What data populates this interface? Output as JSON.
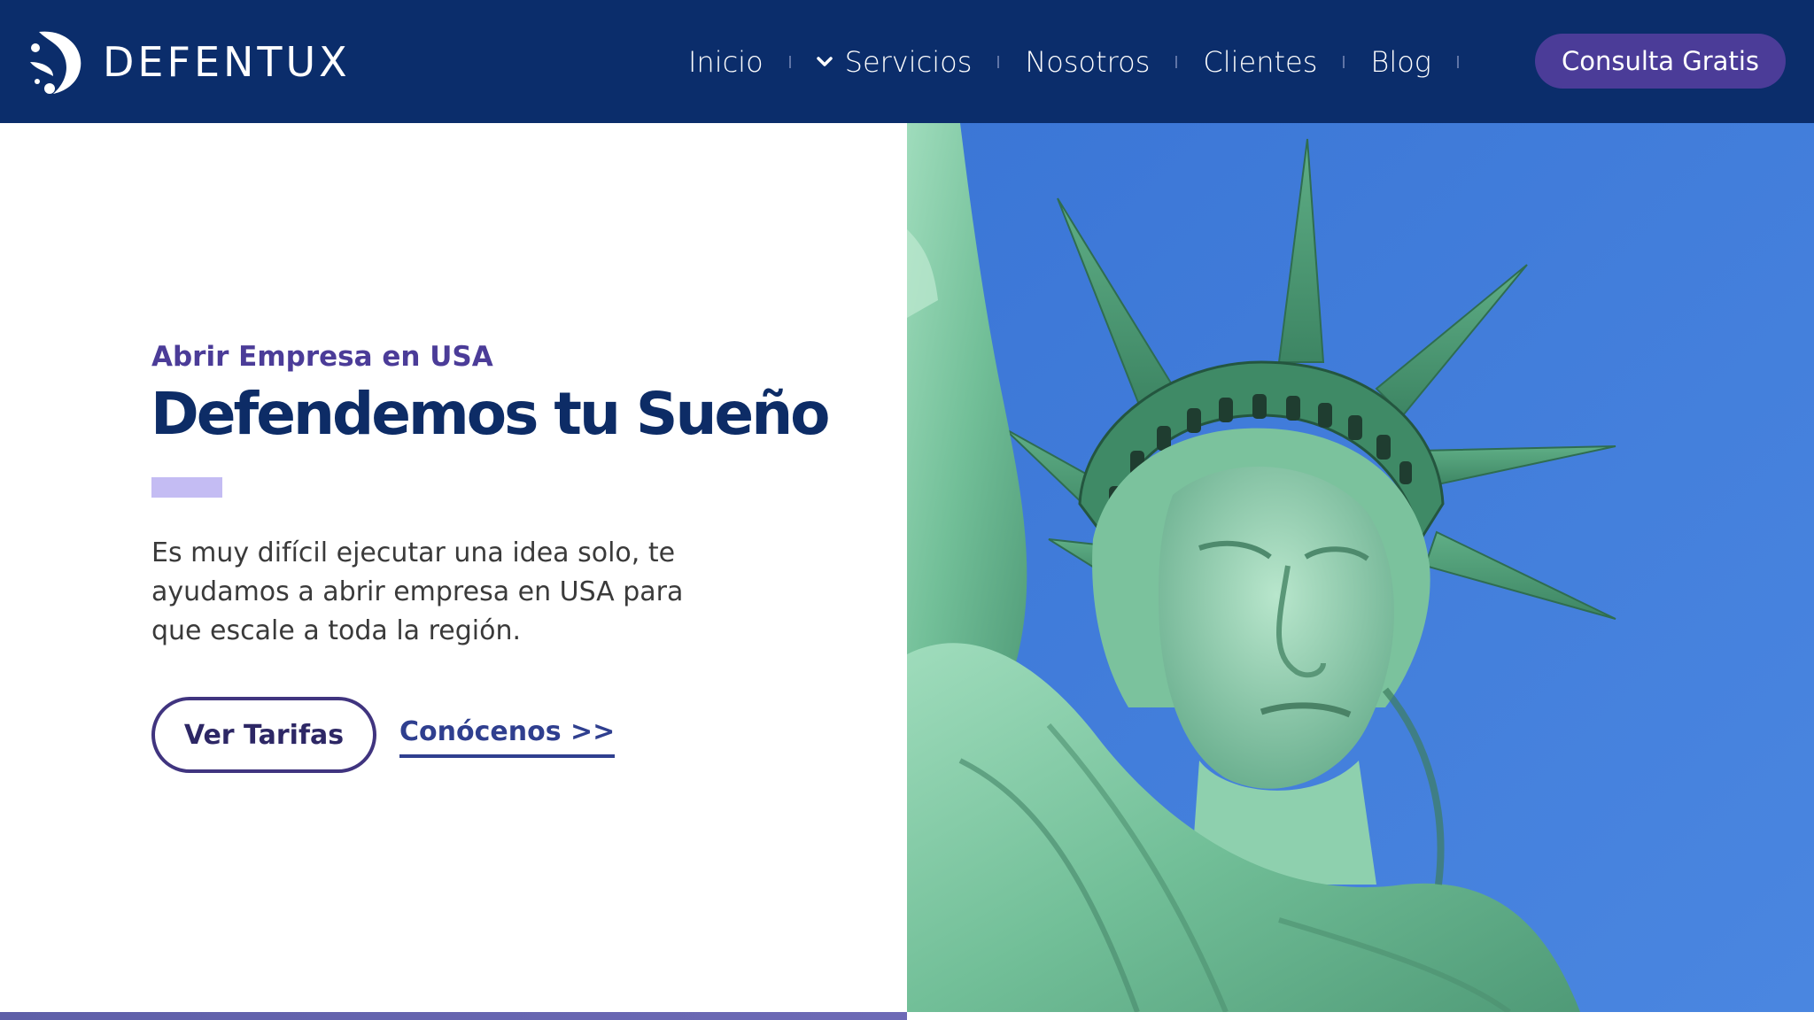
{
  "header": {
    "brand": "DEFENTUX",
    "nav": [
      {
        "label": "Inicio",
        "has_dropdown": false
      },
      {
        "label": "Servicios",
        "has_dropdown": true
      },
      {
        "label": "Nosotros",
        "has_dropdown": false
      },
      {
        "label": "Clientes",
        "has_dropdown": false
      },
      {
        "label": "Blog",
        "has_dropdown": false
      }
    ],
    "cta_label": "Consulta Gratis"
  },
  "hero": {
    "eyebrow": "Abrir Empresa en USA",
    "title": "Defendemos tu Sueño",
    "description": "Es muy difícil ejecutar una idea solo, te ayudamos a abrir empresa en USA para que escale a toda la región.",
    "primary_button": "Ver Tarifas",
    "secondary_link": "Conócenos >>"
  },
  "icons": {
    "logo": "defentux-logo-icon",
    "dropdown": "chevron-down-icon"
  },
  "colors": {
    "header_bg": "#0b2d6b",
    "cta_bg": "#4b3c98",
    "title": "#0d2c66",
    "eyebrow": "#4b3c98",
    "accent_bar": "#c4bcf3",
    "sky": "#3f7ad8",
    "statue": "#7fc7a3"
  }
}
